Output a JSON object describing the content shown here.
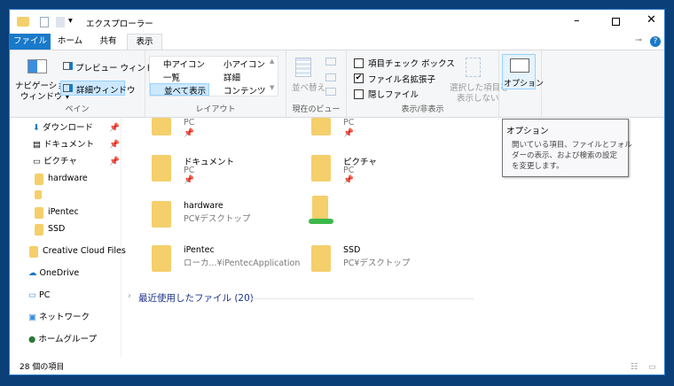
{
  "window": {
    "title": "エクスプローラー"
  },
  "tabs": [
    {
      "label": "ファイル"
    },
    {
      "label": "ホーム"
    },
    {
      "label": "共有"
    },
    {
      "label": "表示"
    }
  ],
  "ribbon": {
    "pane": {
      "label": "ペイン",
      "nav_pane": "ナビゲーション",
      "nav_pane2": "ウィンドウ ▾",
      "preview": "プレビュー ウィンドウ",
      "details": "詳細ウィンドウ"
    },
    "layout": {
      "label": "レイアウト",
      "items": [
        "中アイコン",
        "小アイコン",
        "一覧",
        "詳細",
        "並べて表示",
        "コンテンツ"
      ],
      "selected": "並べて表示"
    },
    "current_view": {
      "label": "現在のビュー",
      "sort": "並べ替え"
    },
    "show_hide": {
      "label": "表示/非表示",
      "item_checkbox": "項目チェック ボックス",
      "item_checkbox_checked": false,
      "extensions": "ファイル名拡張子",
      "extensions_checked": true,
      "hidden": "隠しファイル",
      "hidden_checked": false,
      "hide_selected1": "選択した項目を",
      "hide_selected2": "表示しない"
    },
    "options": {
      "label": "オプション"
    }
  },
  "tooltip": {
    "title": "オプション",
    "line1": "開いている項目、ファイルとフォル",
    "line2": "ダーの表示、および検索の設定",
    "line3": "を変更します。"
  },
  "nav": {
    "items": [
      {
        "label": "ダウンロード",
        "pinned": true
      },
      {
        "label": "ドキュメント",
        "pinned": true
      },
      {
        "label": "ピクチャ",
        "pinned": true
      },
      {
        "label": "hardware"
      },
      {
        "label": ""
      },
      {
        "label": "iPentec"
      },
      {
        "label": "SSD"
      },
      {
        "label": "Creative Cloud Files"
      },
      {
        "label": "OneDrive"
      },
      {
        "label": "PC"
      },
      {
        "label": "ネットワーク"
      },
      {
        "label": "ホームグループ"
      }
    ]
  },
  "main": {
    "tiles": [
      {
        "name": "",
        "sub": "PC"
      },
      {
        "name": "",
        "sub": "PC"
      },
      {
        "name": "ドキュメント",
        "sub": "PC"
      },
      {
        "name": "ピクチャ",
        "sub": "PC"
      },
      {
        "name": "hardware",
        "sub": "PC¥デスクトップ"
      },
      {
        "name": "",
        "sub": ""
      },
      {
        "name": "iPentec",
        "sub": "ローカ...¥iPentecApplication"
      },
      {
        "name": "SSD",
        "sub": "PC¥デスクトップ"
      }
    ],
    "recent": "最近使用したファイル (20)"
  },
  "status": {
    "count": "28 個の項目"
  },
  "colors": {
    "accent": "#1979ca",
    "desktop": "#0b3f78",
    "folder": "#f4cf6b"
  }
}
